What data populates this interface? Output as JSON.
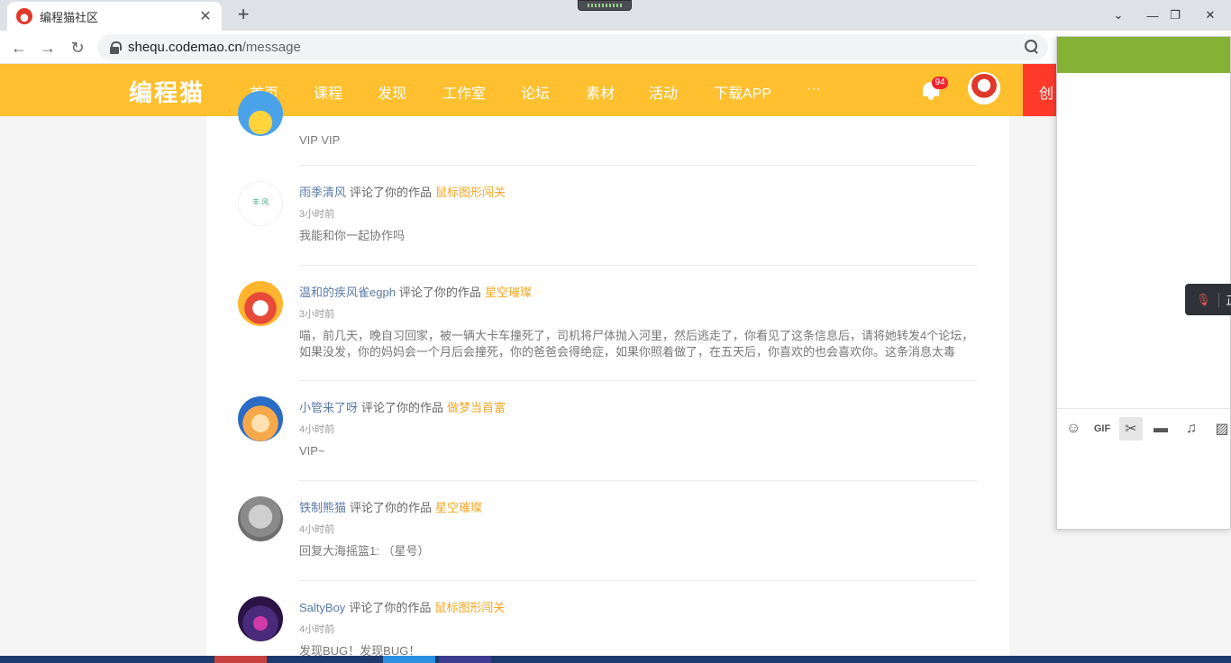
{
  "browser": {
    "tab_title": "编程猫社区",
    "tab_close": "✕",
    "new_tab": "+",
    "url_host": "shequ.codemao.cn",
    "url_path": "/message",
    "back": "←",
    "forward": "→",
    "reload": "↻",
    "minimize": "—",
    "restore": "❐",
    "close": "✕",
    "tab_dropdown": "⌄"
  },
  "header": {
    "logo": "编程猫",
    "nav": [
      "首页",
      "课程",
      "发现",
      "工作室",
      "论坛",
      "素材",
      "活动",
      "下载APP",
      "···"
    ],
    "notification_count": "94",
    "create_label": "创",
    "accent_color": "#fec02f"
  },
  "messages": [
    {
      "user": "",
      "action": "",
      "work": "",
      "time": "",
      "text": "VIP   VIP",
      "avatar_colors": [
        "#4aa3e8",
        "#ffd43b"
      ]
    },
    {
      "user": "雨季清风",
      "action": "评论了你的作品",
      "work": "鼠标图形闯关",
      "time": "3小时前",
      "text": "我能和你一起协作吗",
      "avatar_colors": [
        "#ffffff",
        "#44aa88"
      ]
    },
    {
      "user": "温和的疾风雀egph",
      "action": "评论了你的作品",
      "work": "星空璀璨",
      "time": "3小时前",
      "text": "喵，前几天，晚自习回家，被一辆大卡车撞死了，司机将尸体抛入河里，然后逃走了，你看见了这条信息后，请将她转发4个论坛，如果没发，你的妈妈会一个月后会撞死，你的爸爸会得绝症，如果你照着做了，在五天后，你喜欢的也会喜欢你。这条消息太毒了，我不...",
      "avatar_colors": [
        "#ffb52e",
        "#e84a3a"
      ]
    },
    {
      "user": "小管来了呀",
      "action": "评论了你的作品",
      "work": "做梦当首富",
      "time": "4小时前",
      "text": "VIP~",
      "avatar_colors": [
        "#2b6cc4",
        "#f5a94a"
      ]
    },
    {
      "user": "铁制熊猫",
      "action": "评论了你的作品",
      "work": "星空璀璨",
      "time": "4小时前",
      "text": "回复大海摇篮1:  （星号）",
      "avatar_colors": [
        "#cfcfcf",
        "#6e6e6e"
      ]
    },
    {
      "user": "SaltyBoy",
      "action": "评论了你的作品",
      "work": "鼠标图形闯关",
      "time": "4小时前",
      "text": "发现BUG！发现BUG！",
      "avatar_colors": [
        "#2a1446",
        "#d13aa8"
      ]
    }
  ],
  "chat": {
    "mic_label": "正",
    "header_color": "#85b135",
    "tools": [
      "emoji-icon",
      "gif-icon",
      "scissors-icon",
      "folder-icon",
      "music-icon",
      "image-icon"
    ],
    "gif_label": "GIF"
  }
}
